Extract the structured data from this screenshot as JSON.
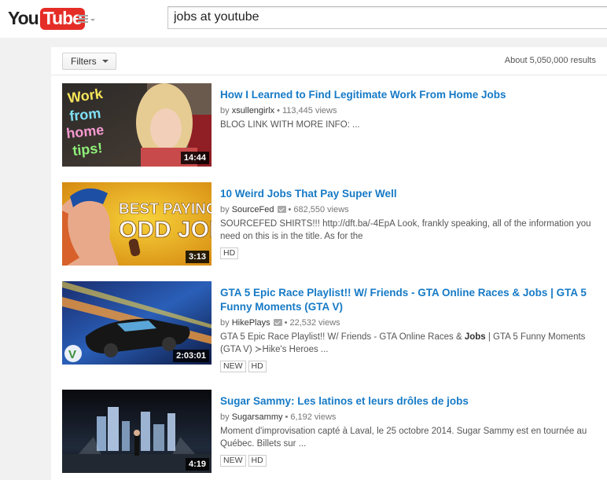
{
  "masthead": {
    "logo_you": "You",
    "logo_tube": "Tube",
    "search_value": "jobs at youtube"
  },
  "filters": {
    "label": "Filters",
    "result_count": "About 5,050,000 results"
  },
  "results": [
    {
      "title": "How I Learned to Find Legitimate Work From Home Jobs",
      "by": "by",
      "channel": "xsullengirlx",
      "verified": false,
      "views": "113,445 views",
      "description": "BLOG LINK WITH MORE INFO: ...",
      "duration": "14:44",
      "badges": [],
      "thumb_text": "Work from home tips!"
    },
    {
      "title": "10 Weird Jobs That Pay Super Well",
      "by": "by",
      "channel": "SourceFed",
      "verified": true,
      "views": "682,550 views",
      "description": "SOURCEFED SHIRTS!!! http://dft.ba/-4EpA Look, frankly speaking, all of the information you need on this is in the title. As for the",
      "duration": "3:13",
      "badges": [
        "HD"
      ],
      "thumb_text": "BEST PAYING ODD JOBS"
    },
    {
      "title": "GTA 5 Epic Race Playlist!! W/ Friends - GTA Online Races & Jobs | GTA 5 Funny Moments (GTA V)",
      "by": "by",
      "channel": "HikePlays",
      "verified": true,
      "views": "22,532 views",
      "description_pre": "GTA 5 Epic Race Playlist!! W/ Friends - GTA Online Races & ",
      "description_bold": "Jobs",
      "description_post": " | GTA 5 Funny Moments (GTA V) ≻Hike's Heroes ...",
      "duration": "2:03:01",
      "badges": [
        "NEW",
        "HD"
      ],
      "thumb_text": "V"
    },
    {
      "title": "Sugar Sammy: Les latinos et leurs drôles de jobs",
      "by": "by",
      "channel": "Sugarsammy",
      "verified": false,
      "views": "6,192 views",
      "description": "Moment d'improvisation capté à Laval, le 25 octobre 2014. Sugar Sammy est en tournée au Québec. Billets sur ...",
      "duration": "4:19",
      "badges": [
        "NEW",
        "HD"
      ],
      "thumb_text": ""
    }
  ]
}
